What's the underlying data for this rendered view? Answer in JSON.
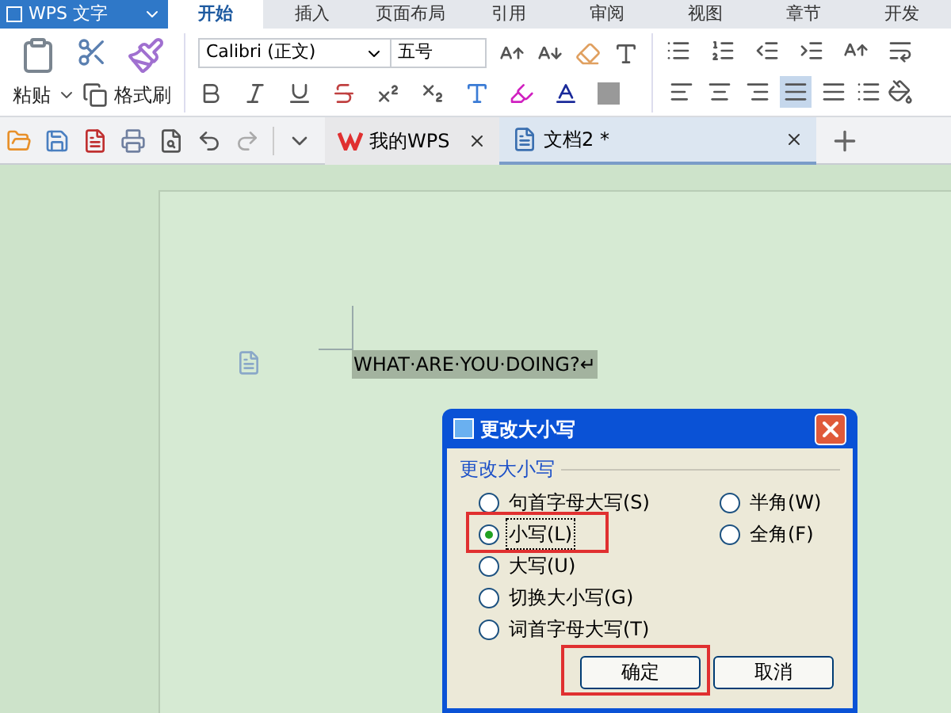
{
  "app": {
    "title": "WPS 文字"
  },
  "tabs": [
    {
      "label": "开始",
      "selected": true
    },
    {
      "label": "插入",
      "selected": false
    },
    {
      "label": "页面布局",
      "selected": false
    },
    {
      "label": "引用",
      "selected": false
    },
    {
      "label": "审阅",
      "selected": false
    },
    {
      "label": "视图",
      "selected": false
    },
    {
      "label": "章节",
      "selected": false
    },
    {
      "label": "开发",
      "selected": false
    }
  ],
  "ribbon": {
    "paste_label": "粘贴",
    "format_painter_label": "格式刷",
    "font_name": "Calibri (正文)",
    "font_size": "五号",
    "align_buttons": [
      {
        "kind": "left",
        "selected": false
      },
      {
        "kind": "center",
        "selected": false
      },
      {
        "kind": "right",
        "selected": false
      },
      {
        "kind": "justify",
        "selected": true
      },
      {
        "kind": "distribute",
        "selected": false
      }
    ]
  },
  "doc_tabs": [
    {
      "label": "我的WPS",
      "kind": "home",
      "selected": false
    },
    {
      "label": "文档2 *",
      "kind": "doc",
      "selected": true
    }
  ],
  "document": {
    "text": "WHAT·ARE·YOU·DOING?↵",
    "selected": true
  },
  "dialog": {
    "title": "更改大小写",
    "group_label": "更改大小写",
    "left_options": [
      {
        "label": "句首字母大写(S)",
        "selected": false,
        "highlighted": false
      },
      {
        "label": "小写(L)",
        "selected": true,
        "highlighted": true
      },
      {
        "label": "大写(U)",
        "selected": false,
        "highlighted": false
      },
      {
        "label": "切换大小写(G)",
        "selected": false,
        "highlighted": false
      },
      {
        "label": "词首字母大写(T)",
        "selected": false,
        "highlighted": false
      }
    ],
    "right_options": [
      {
        "label": "半角(W)",
        "selected": false,
        "highlighted": false
      },
      {
        "label": "全角(F)",
        "selected": false,
        "highlighted": false
      }
    ],
    "buttons": [
      {
        "label": "确定",
        "highlighted": true
      },
      {
        "label": "取消",
        "highlighted": false
      }
    ]
  }
}
